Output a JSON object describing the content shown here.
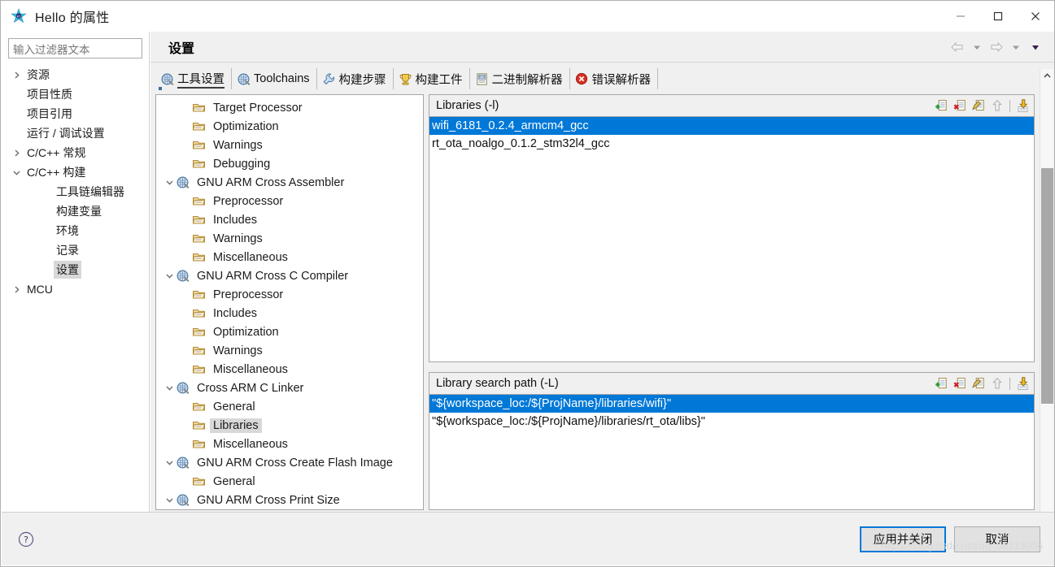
{
  "window": {
    "title": "Hello 的属性",
    "app_icon": "eclipse-star-icon",
    "minimize_label": "–",
    "maximize_label": "□",
    "close_label": "✕"
  },
  "sidebar": {
    "filter": {
      "value": "",
      "placeholder": "输入过滤器文本"
    },
    "items": [
      {
        "label": "资源",
        "indent": 0,
        "twisty": "collapsed",
        "selected": false
      },
      {
        "label": "项目性质",
        "indent": 0,
        "twisty": "none",
        "selected": false
      },
      {
        "label": "项目引用",
        "indent": 0,
        "twisty": "none",
        "selected": false
      },
      {
        "label": "运行 / 调试设置",
        "indent": 0,
        "twisty": "none",
        "selected": false
      },
      {
        "label": "C/C++ 常规",
        "indent": 0,
        "twisty": "collapsed",
        "selected": false
      },
      {
        "label": "C/C++ 构建",
        "indent": 0,
        "twisty": "expanded",
        "selected": false
      },
      {
        "label": "工具链编辑器",
        "indent": 2,
        "twisty": "none",
        "selected": false
      },
      {
        "label": "构建变量",
        "indent": 2,
        "twisty": "none",
        "selected": false
      },
      {
        "label": "环境",
        "indent": 2,
        "twisty": "none",
        "selected": false
      },
      {
        "label": "记录",
        "indent": 2,
        "twisty": "none",
        "selected": false
      },
      {
        "label": "设置",
        "indent": 2,
        "twisty": "none",
        "selected": true
      },
      {
        "label": "MCU",
        "indent": 0,
        "twisty": "collapsed",
        "selected": false
      }
    ]
  },
  "header": {
    "title": "设置",
    "nav": [
      {
        "name": "back-arrow-icon",
        "icon": "arrow-left"
      },
      {
        "name": "back-dropdown-icon",
        "icon": "caret-down"
      },
      {
        "name": "forward-arrow-icon",
        "icon": "arrow-right"
      },
      {
        "name": "forward-dropdown-icon",
        "icon": "caret-down"
      },
      {
        "name": "view-menu-icon",
        "icon": "caret-down-filled"
      }
    ]
  },
  "tabs": [
    {
      "label": "工具设置",
      "icon": "tool-icon",
      "active": true
    },
    {
      "label": "Toolchains",
      "icon": "tool-icon",
      "active": false
    },
    {
      "label": "构建步骤",
      "icon": "wrench-icon",
      "active": false
    },
    {
      "label": "构建工件",
      "icon": "trophy-icon",
      "active": false
    },
    {
      "label": "二进制解析器",
      "icon": "binary-icon",
      "active": false
    },
    {
      "label": "错误解析器",
      "icon": "error-icon",
      "active": false
    }
  ],
  "option_tree": [
    {
      "label": "Target Processor",
      "level": 1,
      "twisty": "none",
      "icon": "folder-icon",
      "selected": false
    },
    {
      "label": "Optimization",
      "level": 1,
      "twisty": "none",
      "icon": "folder-icon",
      "selected": false
    },
    {
      "label": "Warnings",
      "level": 1,
      "twisty": "none",
      "icon": "folder-icon",
      "selected": false
    },
    {
      "label": "Debugging",
      "level": 1,
      "twisty": "none",
      "icon": "folder-icon",
      "selected": false
    },
    {
      "label": "GNU ARM Cross Assembler",
      "level": 0,
      "twisty": "expanded",
      "icon": "tool-icon",
      "selected": false
    },
    {
      "label": "Preprocessor",
      "level": 1,
      "twisty": "none",
      "icon": "folder-icon",
      "selected": false
    },
    {
      "label": "Includes",
      "level": 1,
      "twisty": "none",
      "icon": "folder-icon",
      "selected": false
    },
    {
      "label": "Warnings",
      "level": 1,
      "twisty": "none",
      "icon": "folder-icon",
      "selected": false
    },
    {
      "label": "Miscellaneous",
      "level": 1,
      "twisty": "none",
      "icon": "folder-icon",
      "selected": false
    },
    {
      "label": "GNU ARM Cross C Compiler",
      "level": 0,
      "twisty": "expanded",
      "icon": "tool-icon",
      "selected": false
    },
    {
      "label": "Preprocessor",
      "level": 1,
      "twisty": "none",
      "icon": "folder-icon",
      "selected": false
    },
    {
      "label": "Includes",
      "level": 1,
      "twisty": "none",
      "icon": "folder-icon",
      "selected": false
    },
    {
      "label": "Optimization",
      "level": 1,
      "twisty": "none",
      "icon": "folder-icon",
      "selected": false
    },
    {
      "label": "Warnings",
      "level": 1,
      "twisty": "none",
      "icon": "folder-icon",
      "selected": false
    },
    {
      "label": "Miscellaneous",
      "level": 1,
      "twisty": "none",
      "icon": "folder-icon",
      "selected": false
    },
    {
      "label": "Cross ARM C Linker",
      "level": 0,
      "twisty": "expanded",
      "icon": "tool-icon",
      "selected": false
    },
    {
      "label": "General",
      "level": 1,
      "twisty": "none",
      "icon": "folder-icon",
      "selected": false
    },
    {
      "label": "Libraries",
      "level": 1,
      "twisty": "none",
      "icon": "folder-icon",
      "selected": true
    },
    {
      "label": "Miscellaneous",
      "level": 1,
      "twisty": "none",
      "icon": "folder-icon",
      "selected": false
    },
    {
      "label": "GNU ARM Cross Create Flash Image",
      "level": 0,
      "twisty": "expanded",
      "icon": "tool-icon",
      "selected": false
    },
    {
      "label": "General",
      "level": 1,
      "twisty": "none",
      "icon": "folder-icon",
      "selected": false
    },
    {
      "label": "GNU ARM Cross Print Size",
      "level": 0,
      "twisty": "expanded",
      "icon": "tool-icon",
      "selected": false
    }
  ],
  "panels": [
    {
      "title": "Libraries (-l)",
      "tools": [
        "add-icon",
        "delete-icon",
        "edit-icon",
        "move-up-icon",
        "move-down-icon"
      ],
      "rows": [
        {
          "text": "wifi_6181_0.2.4_armcm4_gcc",
          "selected": true
        },
        {
          "text": "rt_ota_noalgo_0.1.2_stm32l4_gcc",
          "selected": false
        }
      ]
    },
    {
      "title": "Library search path (-L)",
      "tools": [
        "add-icon",
        "delete-icon",
        "edit-icon",
        "move-up-icon",
        "move-down-icon"
      ],
      "rows": [
        {
          "text": "\"${workspace_loc:/${ProjName}/libraries/wifi}\"",
          "selected": true
        },
        {
          "text": "\"${workspace_loc:/${ProjName}/libraries/rt_ota/libs}\"",
          "selected": false
        }
      ]
    }
  ],
  "footer": {
    "help_label": "?",
    "apply_label": "应用并关闭",
    "cancel_label": "取消"
  },
  "watermark": "https://blog.csdn.net/qq_38113006",
  "colors": {
    "selection_blue": "#0078d7",
    "tree_selection_gray": "#d8d8d8",
    "panel_bg": "#f0f0f0",
    "border": "#a6a6a6",
    "default_button_border": "#0078d7"
  }
}
